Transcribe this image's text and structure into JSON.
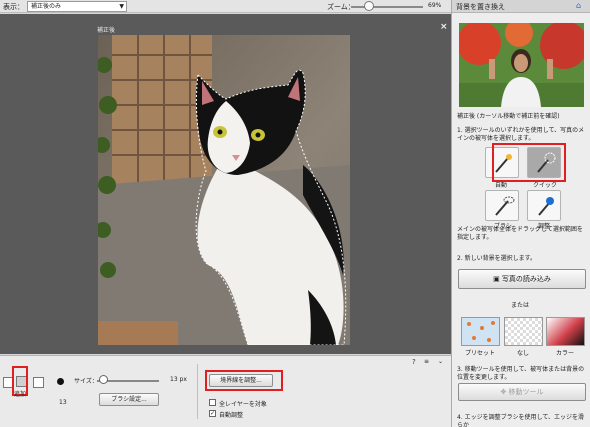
{
  "toolbar": {
    "view_label": "表示：",
    "view_value": "補正後のみ",
    "zoom_label": "ズーム：",
    "zoom_value": "69%",
    "zoom_level_fraction": 0.25
  },
  "canvas": {
    "after_label": "補正後",
    "close_glyph": "×"
  },
  "options": {
    "add_label": "追加",
    "size_label": "サイズ：",
    "size_value": "13 px",
    "size_number": "13",
    "size_level_fraction": 0.05,
    "brush_settings_label": "ブラシ設定...",
    "refine_edge_label": "境界線を調整...",
    "all_layers_label": "全レイヤーを対象",
    "auto_enhance_label": "自動調整",
    "all_layers_checked": false,
    "auto_enhance_checked": true,
    "help_glyph": "?",
    "menu_glyph": "≡",
    "collapse_glyph": "⌄"
  },
  "panel": {
    "title": "背景を置き換え",
    "after_hint": "補正後 (カーソル移動で補正前を確認)",
    "step1": "1. 選択ツールのいずれかを使用して、写真のメインの被写体を選択します。",
    "tools": [
      {
        "label": "自動",
        "icon": "auto-select-icon"
      },
      {
        "label": "クイック",
        "icon": "quick-selection-icon"
      },
      {
        "label": "ブラシ",
        "icon": "brush-icon"
      },
      {
        "label": "調整",
        "icon": "refine-brush-icon"
      }
    ],
    "step1b": "メインの被写体全体をドラッグして選択範囲を指定します。",
    "step2": "2. 新しい背景を選択します。",
    "load_photo_label": "写真の読み込み",
    "or_label": "または",
    "swatches": [
      {
        "label": "プリセット",
        "color": "#cfe3f2"
      },
      {
        "label": "なし",
        "color": "#f4f4f4"
      },
      {
        "label": "カラー",
        "color": "#b01a20"
      }
    ],
    "step3": "3. 移動ツールを使用して、被写体または背景の位置を変更します。",
    "move_tool_label": "移動ツール",
    "step4": "4. エッジを調整ブラシを使用して、エッジを滑らか"
  },
  "colors": {
    "highlight": "#e02020",
    "accent_blue": "#1a6fd0"
  }
}
